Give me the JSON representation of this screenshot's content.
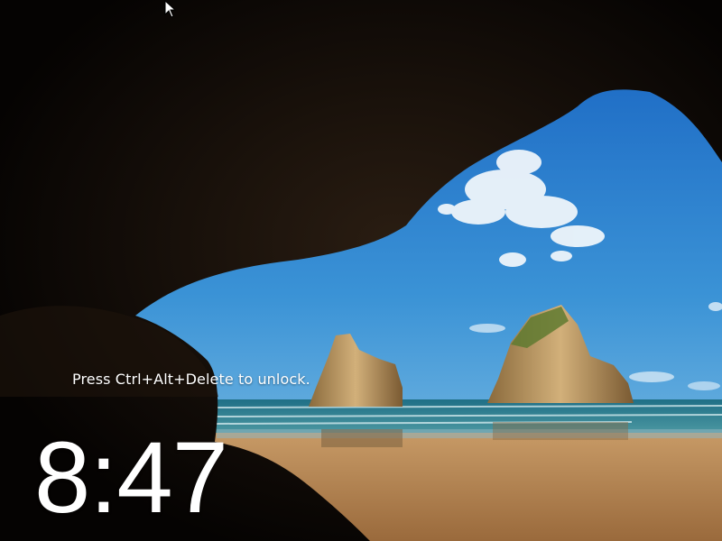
{
  "lock_screen": {
    "prompt": "Press Ctrl+Alt+Delete to unlock.",
    "time": "8:47"
  },
  "wallpaper": {
    "subject": "sea cave opening onto a sandy beach with rock stacks",
    "sky_color": "#2e86d1",
    "sea_color": "#2f7c8e",
    "sand_color": "#b9895a",
    "cave_color": "#0b0806"
  },
  "cursor": {
    "icon": "arrow-pointer-icon"
  }
}
